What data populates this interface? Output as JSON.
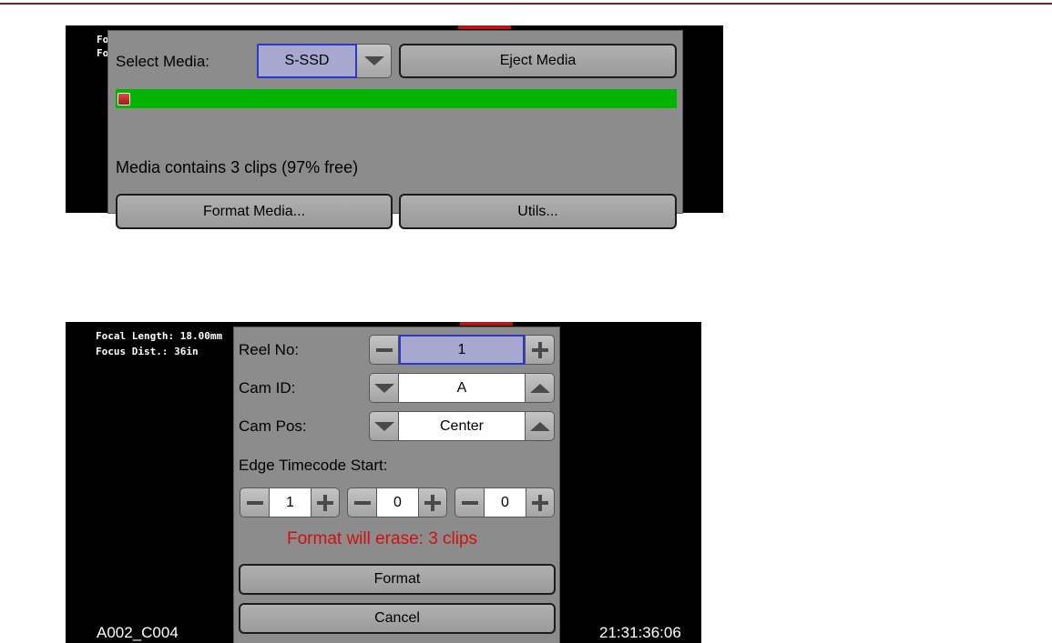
{
  "screen1": {
    "overlay_lines": [
      "Fo",
      "Fo"
    ],
    "select_media_label": "Select Media:",
    "media_value": "S-SSD",
    "eject_label": "Eject Media",
    "media_usage_percent": 3,
    "status_text": "Media contains 3 clips (97% free)",
    "format_media_label": "Format Media...",
    "utils_label": "Utils..."
  },
  "screen2": {
    "overlay_line1": "Focal Length: 18.00mm",
    "overlay_line2": "Focus Dist.: 36in",
    "reel_label": "Reel No:",
    "reel_value": "1",
    "cam_id_label": "Cam ID:",
    "cam_id_value": "A",
    "cam_pos_label": "Cam Pos:",
    "cam_pos_value": "Center",
    "edge_tc_label": "Edge Timecode Start:",
    "tc_values": [
      "1",
      "0",
      "0"
    ],
    "warning_text": "Format will erase: 3 clips",
    "format_label": "Format",
    "cancel_label": "Cancel",
    "clip_name": "A002_C004",
    "timecode": "21:31:36:06"
  },
  "colors": {
    "accent_red": "#b01818",
    "progress_green": "#00b400",
    "selection_blue": "#2d38c8",
    "warning_red": "#d01010"
  }
}
